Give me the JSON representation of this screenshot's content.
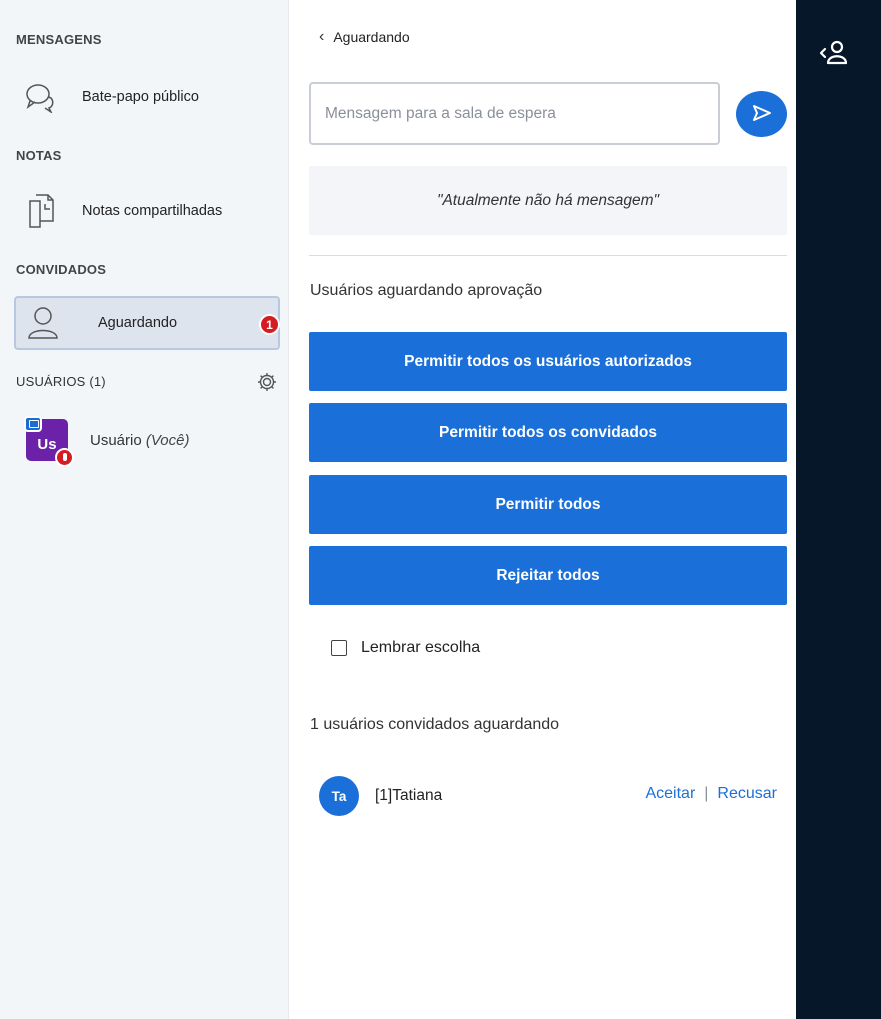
{
  "sidebar": {
    "messages_title": "MENSAGENS",
    "public_chat": "Bate-papo público",
    "notes_title": "NOTAS",
    "shared_notes": "Notas compartilhadas",
    "guests_title": "CONVIDADOS",
    "waiting": "Aguardando",
    "waiting_badge": "1",
    "users_title": "USUÁRIOS (1)",
    "user_avatar": "Us",
    "user_name": "Usuário",
    "user_you": "(Você)"
  },
  "main": {
    "back_title": "Aguardando",
    "message_placeholder": "Mensagem para a sala de espera",
    "empty_message": "\"Atualmente não há mensagem\"",
    "waiting_approval": "Usuários aguardando aprovação",
    "buttons": [
      "Permitir todos os usuários autorizados",
      "Permitir todos os convidados",
      "Permitir todos",
      "Rejeitar todos"
    ],
    "remember_choice": "Lembrar escolha",
    "guests_waiting": "1 usuários convidados aguardando",
    "guest": {
      "initials": "Ta",
      "name": "[1]Tatiana",
      "accept": "Aceitar",
      "separator": "|",
      "reject": "Recusar"
    }
  },
  "colors": {
    "accent": "#1b6fd8",
    "rail": "#06172a",
    "badge": "#d41d23",
    "user_avatar": "#6b21a8"
  },
  "icons": [
    "chat-icon",
    "notes-icon",
    "user-icon",
    "gear-icon",
    "send-icon",
    "users-toggle-icon",
    "chevron-left-icon"
  ]
}
